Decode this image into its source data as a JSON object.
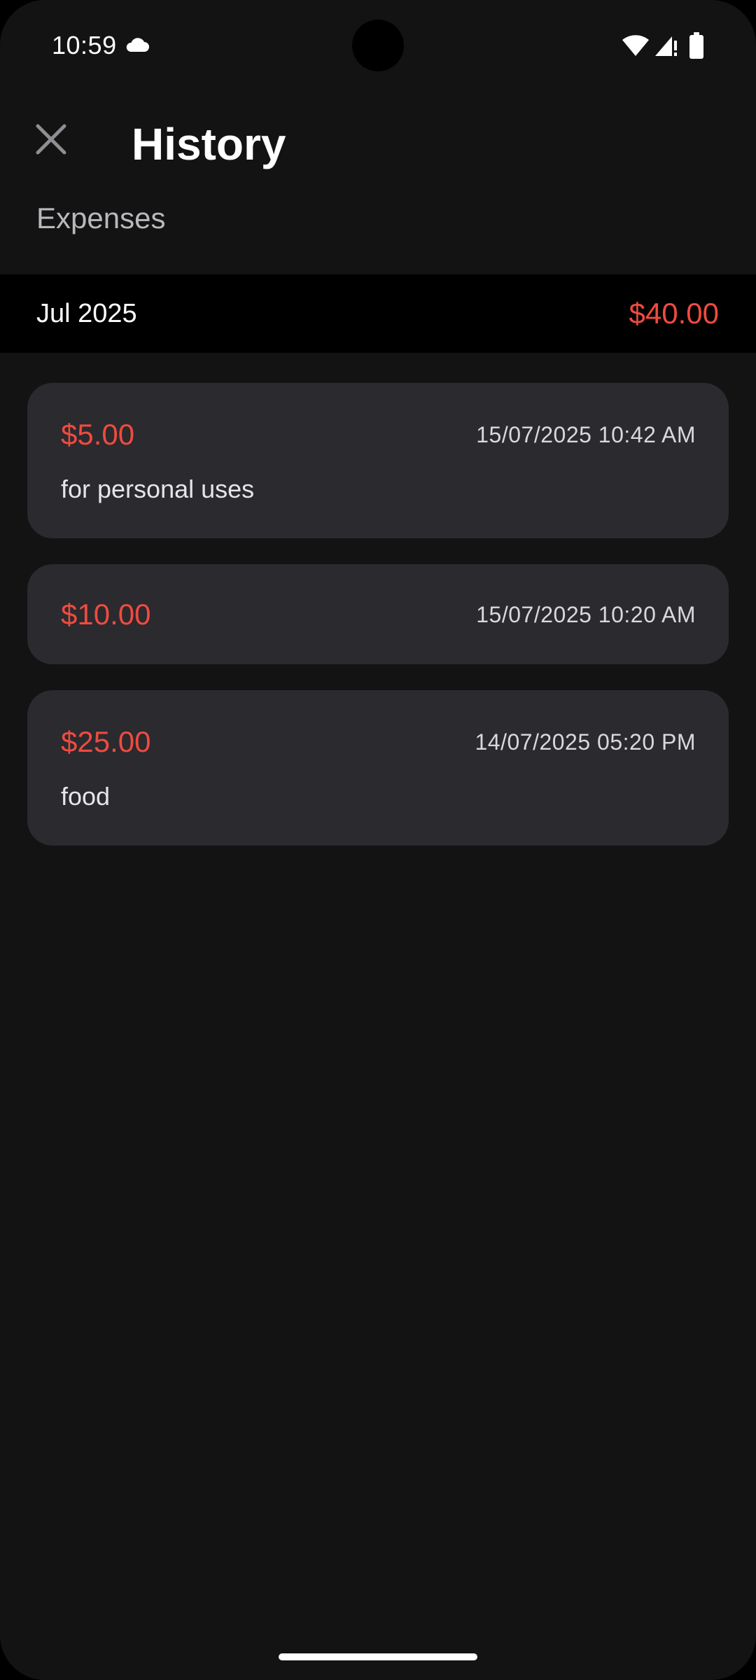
{
  "status_bar": {
    "time": "10:59",
    "icons": [
      "cloud-icon",
      "wifi-icon",
      "signal-icon",
      "battery-icon"
    ]
  },
  "header": {
    "close_icon": "close-icon",
    "title": "History",
    "subtitle": "Expenses"
  },
  "month": {
    "label": "Jul 2025",
    "total": "$40.00"
  },
  "transactions": [
    {
      "amount": "$5.00",
      "datetime": "15/07/2025 10:42 AM",
      "note": "for personal uses"
    },
    {
      "amount": "$10.00",
      "datetime": "15/07/2025 10:20 AM",
      "note": ""
    },
    {
      "amount": "$25.00",
      "datetime": "14/07/2025 05:20 PM",
      "note": "food"
    }
  ],
  "colors": {
    "background": "#131314",
    "card": "#2a2a2f",
    "accent_expense": "#ef4b3f",
    "month_band": "#000000"
  }
}
